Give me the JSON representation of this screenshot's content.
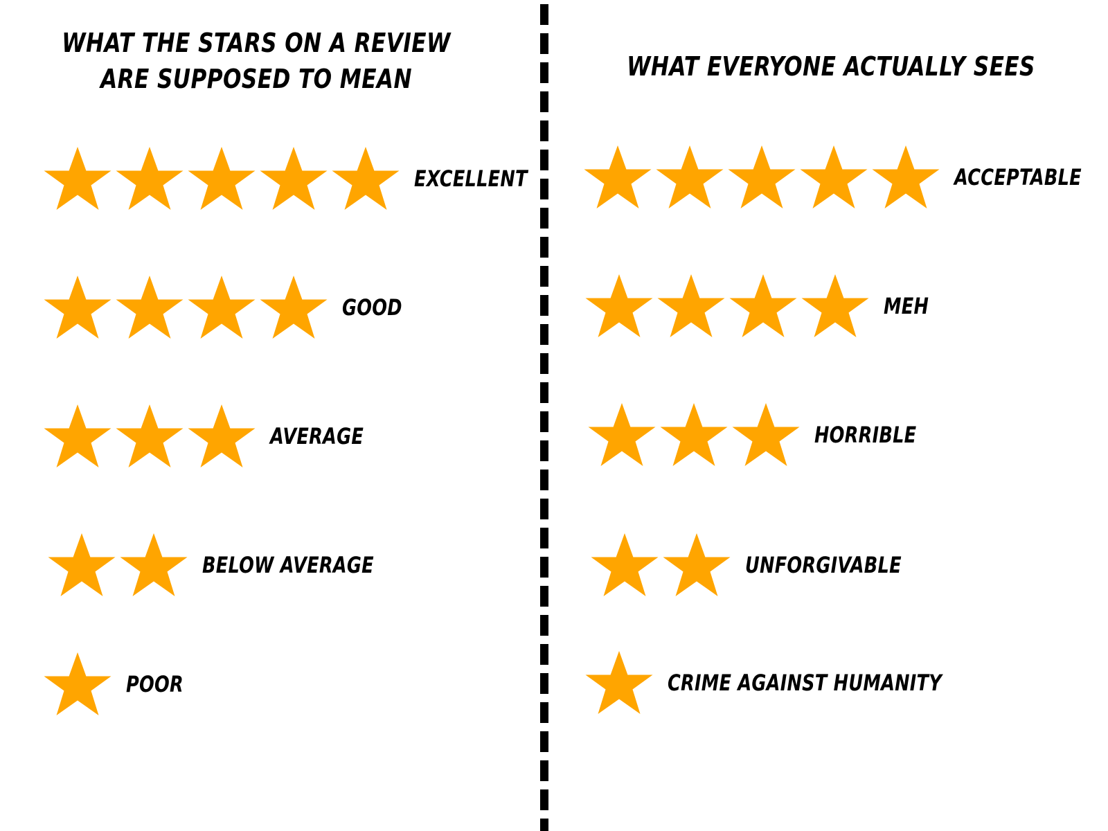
{
  "left": {
    "title_line1": "What the stars on a review",
    "title_line2": "are supposed to mean",
    "rows": [
      {
        "stars": 5,
        "label": "Excellent"
      },
      {
        "stars": 4,
        "label": "Good"
      },
      {
        "stars": 3,
        "label": "Average"
      },
      {
        "stars": 2,
        "label": "Below average"
      },
      {
        "stars": 1,
        "label": "Poor"
      }
    ]
  },
  "right": {
    "title": "What everyone actually sees",
    "rows": [
      {
        "stars": 5,
        "label": "Acceptable"
      },
      {
        "stars": 4,
        "label": "Meh"
      },
      {
        "stars": 3,
        "label": "Horrible"
      },
      {
        "stars": 2,
        "label": "Unforgivable"
      },
      {
        "stars": 1,
        "label": "Crime against humanity"
      }
    ]
  },
  "colors": {
    "star": "#FFA500",
    "text": "#000000",
    "divider": "#000000"
  },
  "icons": {
    "star": "star-icon"
  }
}
